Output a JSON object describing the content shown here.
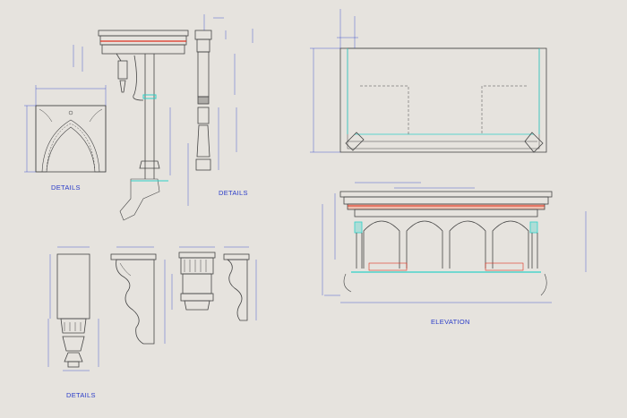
{
  "labels": {
    "details_1": "DETAILS",
    "details_2": "DETAILS",
    "details_3": "DETAILS",
    "elevation": "ELEVATION"
  },
  "colors": {
    "background": "#e6e3de",
    "linework": "#454545",
    "dimension": "#2a3cc8",
    "highlight_red": "#e0301e",
    "highlight_cyan": "#2fd2c8",
    "highlight_salmon": "#f2a088"
  }
}
